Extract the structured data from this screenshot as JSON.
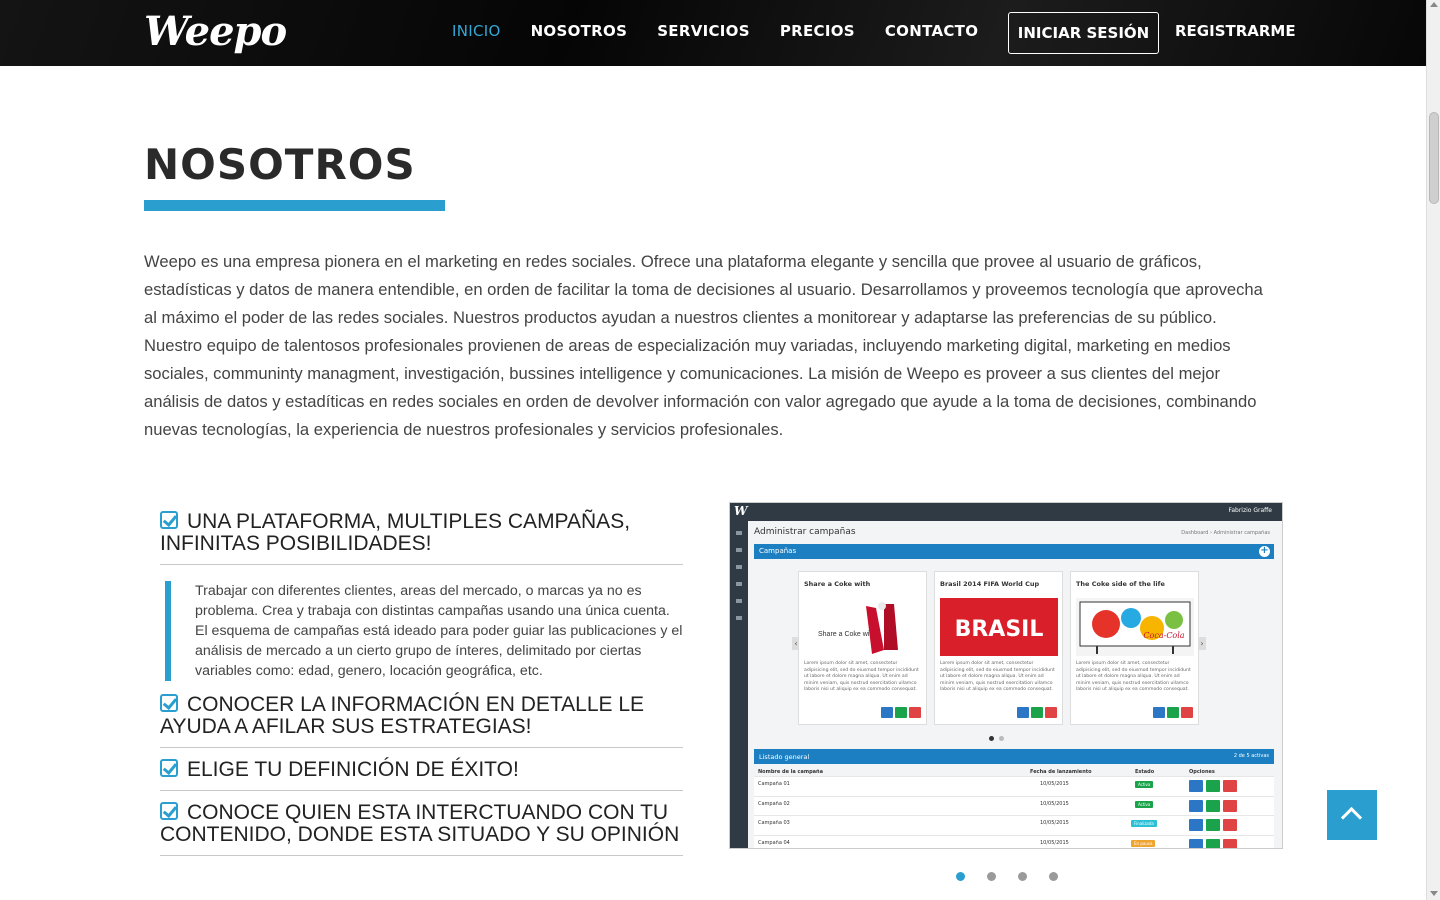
{
  "nav": {
    "logo": "Weepo",
    "links": [
      "INICIO",
      "NOSOTROS",
      "SERVICIOS",
      "PRECIOS",
      "CONTACTO"
    ],
    "active_index": 0,
    "login_label": "INICIAR SESIÓN",
    "register_label": "REGISTRARME"
  },
  "colors": {
    "accent": "#2a9fcf",
    "navbar": "#0b0b0b",
    "text": "#444444",
    "title": "#2a2a2a"
  },
  "section": {
    "title": "NOSOTROS",
    "intro": "Weepo es una empresa pionera en el marketing en redes sociales. Ofrece una plataforma elegante y sencilla que provee al usuario de gráficos, estadísticas y datos de manera entendible, en orden de facilitar la toma de decisiones al usuario. Desarrollamos y proveemos tecnología que aprovecha al máximo el poder de las redes sociales. Nuestros productos ayudan a nuestros clientes a monitorear y adaptarse las preferencias de su público. Nuestro equipo de talentosos profesionales provienen de areas de especialización muy variadas, incluyendo marketing digital, marketing en medios sociales, communinty managment, investigación, bussines intelligence y comunicaciones. La misión de Weepo es proveer a sus clientes del mejor análisis de datos y estadíticas en redes sociales en orden de devolver información con valor agregado que ayude a la toma de decisiones, combinando nuevas tecnologías, la experiencia de nuestros profesionales y servicios profesionales."
  },
  "features": [
    {
      "title": "UNA PLATAFORMA, MULTIPLES CAMPAÑAS, INFINITAS POSIBILIDADES!",
      "body": "Trabajar con diferentes clientes, areas del mercado, o marcas ya no es problema. Crea y trabaja con distintas campañas usando una única cuenta. El esquema de campañas está ideado para poder guiar las publicaciones y el análisis de mercado a un cierto grupo de ínteres, delimitado por ciertas variables como: edad, genero, locación geográfica, etc.",
      "icon": "check-square-icon"
    },
    {
      "title": "CONOCER LA INFORMACIÓN EN DETALLE LE AYUDA A AFILAR SUS ESTRATEGIAS!",
      "icon": "check-square-icon"
    },
    {
      "title": "ELIGE TU DEFINICIÓN DE ÉXITO!",
      "icon": "check-square-icon"
    },
    {
      "title": "CONOCE QUIEN ESTA INTERCTUANDO CON TU CONTENIDO, DONDE ESTA SITUADO Y SU OPINIÓN",
      "icon": "check-square-icon"
    }
  ],
  "screenshot": {
    "logo": "W",
    "user": "Fabrizio Graffe",
    "page_title": "Administrar campañas",
    "breadcrumb": "Dashboard  ›  Administrar campañas",
    "campaigns_bar": "Campañas",
    "cards": [
      {
        "title": "Share a Coke with",
        "img_text": "Share a Coke with...",
        "text": "Lorem ipsum dolor sit amet, consectetur adipisicing elit, sed do eiusmod tempor incididunt ut labore et dolore magna aliqua. Ut enim ad minim veniam, quis nostrud exercitation ullamco laboris nisi ut aliquip ex ea commodo consequat."
      },
      {
        "title": "Brasil 2014 FIFA World Cup",
        "img_text": "BRASIL",
        "text": "Lorem ipsum dolor sit amet, consectetur adipisicing elit, sed do eiusmod tempor incididunt ut labore et dolore magna aliqua. Ut enim ad minim veniam, quis nostrud exercitation ullamco laboris nisi ut aliquip ex ea commodo consequat."
      },
      {
        "title": "The Coke side of the life",
        "img_text": "Coca-Cola",
        "text": "Lorem ipsum dolor sit amet, consectetur adipisicing elit, sed do eiusmod tempor incididunt ut labore et dolore magna aliqua. Ut enim ad minim veniam, quis nostrud exercitation ullamco laboris nisi ut aliquip ex ea commodo consequat."
      }
    ],
    "list_bar": "Listado general",
    "list_count": "2 de 5 activas",
    "table_headers": [
      "Nombre de la campaña",
      "Fecha de lanzamiento",
      "Estado",
      "Opciones"
    ],
    "rows": [
      {
        "name": "Campaña 01",
        "date": "10/05/2015",
        "status": "Activa",
        "status_color": "#1aa34a"
      },
      {
        "name": "Campaña 02",
        "date": "10/05/2015",
        "status": "Activa",
        "status_color": "#1aa34a"
      },
      {
        "name": "Campaña 03",
        "date": "10/05/2015",
        "status": "Finalizada",
        "status_color": "#2cc0d6"
      },
      {
        "name": "Campaña 04",
        "date": "10/05/2015",
        "status": "En pausa",
        "status_color": "#f0a430"
      }
    ]
  },
  "carousel": {
    "count": 4,
    "active_index": 0
  }
}
